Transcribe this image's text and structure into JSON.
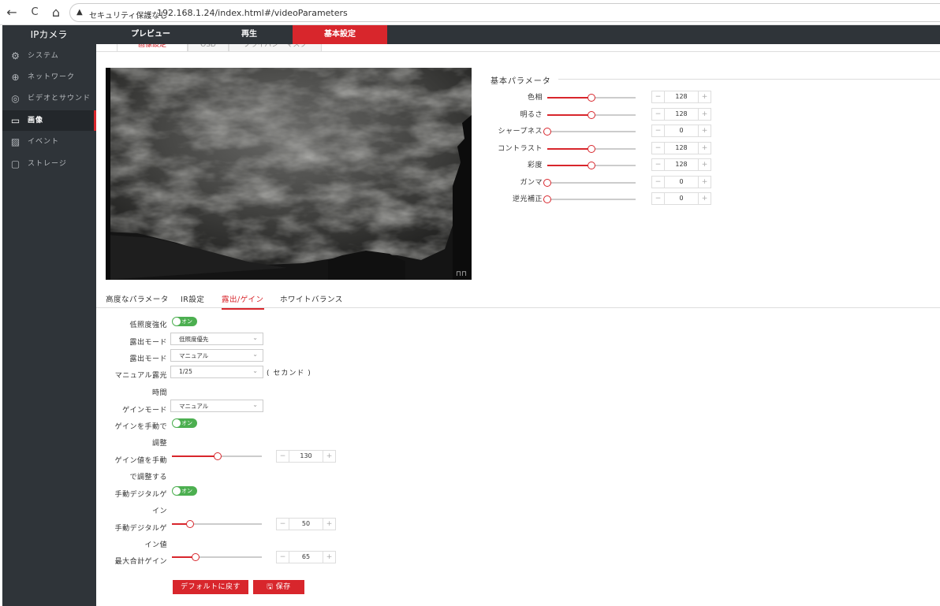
{
  "browser": {
    "back_icon": "←",
    "reload_icon": "C",
    "home_icon": "⌂",
    "warning_icon": "▲",
    "security_text": "セキュリティ保護なし",
    "url": "192.168.1.24/index.html#/videoParameters"
  },
  "topnav": {
    "brand": "IPカメラ",
    "items": [
      {
        "label": "プレビュー"
      },
      {
        "label": "再生"
      },
      {
        "label": "基本設定"
      }
    ]
  },
  "sidebar": {
    "items": [
      {
        "label": "システム",
        "icon": "⚙"
      },
      {
        "label": "ネットワーク",
        "icon": "⊕"
      },
      {
        "label": "ビデオとサウンド",
        "icon": "◎"
      },
      {
        "label": "画像",
        "icon": "▭"
      },
      {
        "label": "イベント",
        "icon": "▨"
      },
      {
        "label": "ストレージ",
        "icon": "▢"
      }
    ]
  },
  "subtabs": [
    {
      "label": "画像設定"
    },
    {
      "label": "OSD"
    },
    {
      "label": "プライバシーマスク"
    }
  ],
  "basic_params": {
    "title": "基本パラメータ",
    "rows": [
      {
        "label": "色相",
        "value": "128",
        "level": 0.5
      },
      {
        "label": "明るさ",
        "value": "128",
        "level": 0.5
      },
      {
        "label": "シャープネス",
        "value": "0",
        "level": 0
      },
      {
        "label": "コントラスト",
        "value": "128",
        "level": 0.5
      },
      {
        "label": "彩度",
        "value": "128",
        "level": 0.5
      },
      {
        "label": "ガンマ",
        "value": "0",
        "level": 0
      },
      {
        "label": "逆光補正",
        "value": "0",
        "level": 0
      }
    ]
  },
  "stepper": {
    "minus": "−",
    "plus": "+"
  },
  "adv_tabs": [
    {
      "label": "高度なパラメータ"
    },
    {
      "label": "IR設定"
    },
    {
      "label": "露出/ゲイン"
    },
    {
      "label": "ホワイトバランス"
    }
  ],
  "form": {
    "low_light_label": "低照度強化",
    "toggle_text": "オン",
    "exposure_mode1_label": "露出モード",
    "exposure_mode1_value": "低照度優先",
    "exposure_mode2_label": "露出モード",
    "exposure_mode2_value": "マニュアル",
    "manual_exposure_label_1": "マニュアル露光",
    "manual_exposure_label_2": "時間",
    "manual_exposure_value": "1/25",
    "seconds_unit": "( セカンド )",
    "gain_mode_label": "ゲインモード",
    "gain_mode_value": "マニュアル",
    "gain_manual_label_1": "ゲインを手動で",
    "gain_manual_label_2": "調整",
    "gain_value_label_1": "ゲイン値を手動",
    "gain_value_label_2": "で調整する",
    "gain_value": "130",
    "gain_level": 0.51,
    "digital_gain_label_1": "手動デジタルゲ",
    "digital_gain_label_2": "イン",
    "digital_gain_value_label_1": "手動デジタルゲ",
    "digital_gain_value_label_2": "イン値",
    "digital_gain_value": "50",
    "digital_gain_level": 0.2,
    "max_gain_label": "最大合計ゲイン",
    "max_gain_value": "65",
    "max_gain_level": 0.26,
    "chevron_icon": "⌄"
  },
  "buttons": {
    "default_label": "デフォルトに戻す",
    "save_icon": "🖫",
    "save_label": "保存"
  },
  "colors": {
    "accent": "#d8262c",
    "nav_bg": "#2f3439",
    "toggle_on": "#4caf50"
  }
}
